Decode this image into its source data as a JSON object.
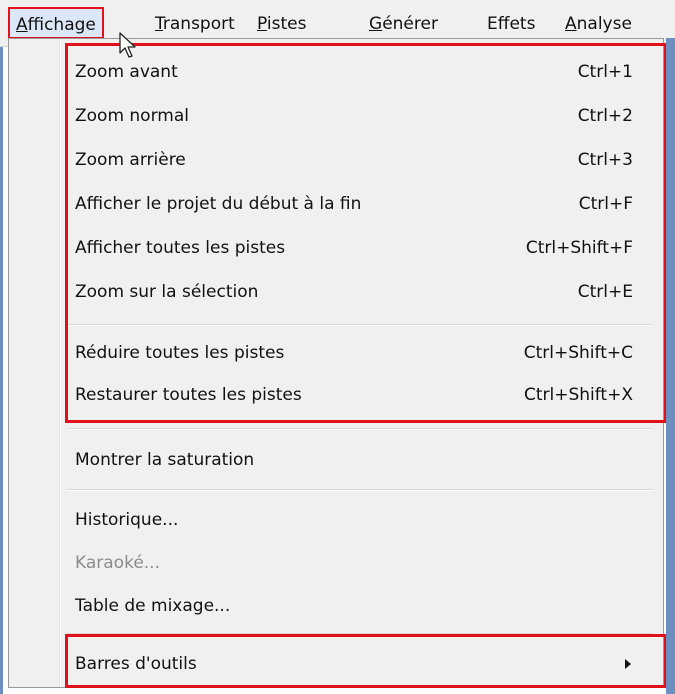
{
  "menubar": {
    "affichage": {
      "underline": "A",
      "rest": "ffichage"
    },
    "transport": {
      "underline": "T",
      "rest": "ransport"
    },
    "pistes": {
      "underline": "P",
      "rest": "istes"
    },
    "generer": {
      "underline": "G",
      "rest": "énérer"
    },
    "effets": {
      "pre": "Ef",
      "underline": "f",
      "rest": "ets"
    },
    "analyse": {
      "underline": "A",
      "rest": "nalyse"
    }
  },
  "menu": {
    "items": [
      {
        "label": "Zoom avant",
        "shortcut": "Ctrl+1"
      },
      {
        "label": "Zoom normal",
        "shortcut": "Ctrl+2"
      },
      {
        "label": "Zoom arrière",
        "shortcut": "Ctrl+3"
      },
      {
        "label": "Afficher le projet du début à la fin",
        "shortcut": "Ctrl+F"
      },
      {
        "label": "Afficher toutes les pistes",
        "shortcut": "Ctrl+Shift+F"
      },
      {
        "label": "Zoom sur la sélection",
        "shortcut": "Ctrl+E"
      },
      {
        "label": "Réduire toutes les pistes",
        "shortcut": "Ctrl+Shift+C"
      },
      {
        "label": "Restaurer toutes les pistes",
        "shortcut": "Ctrl+Shift+X"
      },
      {
        "label": "Montrer la saturation",
        "shortcut": ""
      },
      {
        "label": "Historique...",
        "shortcut": ""
      },
      {
        "label": "Karaoké...",
        "shortcut": "",
        "disabled": true
      },
      {
        "label": "Table de mixage...",
        "shortcut": ""
      },
      {
        "label": "Barres d'outils",
        "shortcut": ""
      }
    ]
  },
  "colors": {
    "highlight_border": "#e0111b",
    "menu_bg": "#f0f0f0",
    "disabled_text": "#8c8c8c"
  }
}
